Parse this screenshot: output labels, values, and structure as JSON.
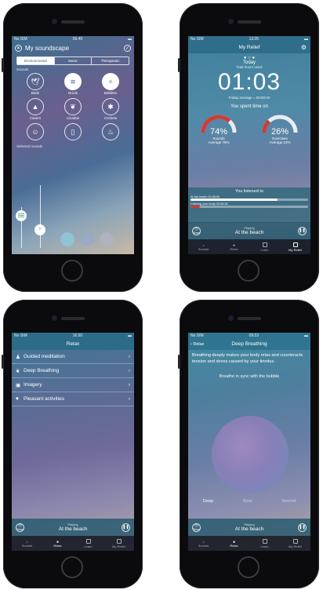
{
  "screen1": {
    "status": {
      "carrier": "No SIM",
      "time": "09.49"
    },
    "title": "My soundscape",
    "tabs": [
      "Environmental",
      "Music",
      "Therapeutic"
    ],
    "section_sounds": "Sounds",
    "sounds": [
      {
        "label": "Birds",
        "icon": "bird-icon"
      },
      {
        "label": "Brook",
        "icon": "waves-icon"
      },
      {
        "label": "Bubbles",
        "icon": "bubbles-icon"
      },
      {
        "label": "Cavern",
        "icon": "mountain-icon"
      },
      {
        "label": "Cicadas",
        "icon": "cicada-icon"
      },
      {
        "label": "Crickets",
        "icon": "cricket-icon"
      },
      {
        "label": "",
        "icon": "people-icon"
      },
      {
        "label": "",
        "icon": "door-icon"
      },
      {
        "label": "",
        "icon": "fire-icon"
      }
    ],
    "section_selected": "Selected sounds"
  },
  "screen2": {
    "status": {
      "carrier": "No SIM",
      "time": "13.05"
    },
    "title": "My Relief",
    "today": "Today",
    "total_hours": "Total hours used:",
    "time": "01:03",
    "friday_avg": "Friday average = 00:00:00",
    "spent": "You spent time on",
    "gauges": [
      {
        "pct": "74%",
        "label": "Sounds",
        "avg": "Average 76%",
        "value": 74
      },
      {
        "pct": "26%",
        "label": "Exercises",
        "avg": "Average 24%",
        "value": 26
      }
    ],
    "listened": "You listened to",
    "tracks": [
      {
        "name": "At the beach",
        "time": "00:46:54",
        "progress": 0.74
      },
      {
        "name": "Calming your body",
        "time": "00:08:28",
        "progress": 0.08
      }
    ],
    "player": {
      "playing": "Playing",
      "track": "At the beach",
      "timer": "Timer"
    },
    "tabbar": [
      "Sounds",
      "Relax",
      "Learn",
      "My Relief"
    ],
    "active_tab": 3
  },
  "screen3": {
    "status": {
      "carrier": "No SIM",
      "time": "16.50"
    },
    "title": "Relax",
    "items": [
      "Guided meditation",
      "Deep Breathing",
      "Imagery",
      "Pleasant activities"
    ],
    "player": {
      "playing": "Playing",
      "track": "At the beach",
      "timer": "Timer"
    },
    "tabbar": [
      "Sounds",
      "Relax",
      "Learn",
      "My Relief"
    ],
    "active_tab": 1
  },
  "screen4": {
    "status": {
      "carrier": "No SIM",
      "time": "09.53"
    },
    "back": "Relax",
    "title": "Deep Breathing",
    "body": "Breathing deeply makes your body relax and counteracts tension and stress caused by your tinnitus.",
    "hint": "Breathe in sync with the bubble",
    "speeds": [
      "Deep",
      "Slow",
      "Normal"
    ],
    "player": {
      "playing": "Playing",
      "track": "At the beach",
      "timer": "Timer"
    },
    "tabbar": [
      "Sounds",
      "Relax",
      "Learn",
      "My Relief"
    ],
    "active_tab": 1
  }
}
